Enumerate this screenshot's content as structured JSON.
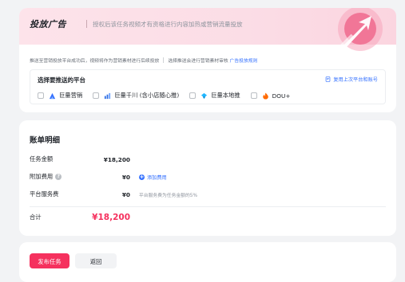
{
  "ad_section": {
    "title": "投放广告",
    "description": "授权后该任务视频才有资格进行内容加热或营销流量投放",
    "notice": "推送至营销投放平台成功后，视频将作为营销素材进行后续投放",
    "notice_select": "选择推送会进行营销素材审核",
    "rules_link": "广告投放规则",
    "platform_title": "选择要推送的平台",
    "reuse_link": "复用上次平台和账号",
    "platforms": [
      {
        "label": "巨量营销",
        "icon": "ocean-engine-icon",
        "color": "#3370ff",
        "checked": false
      },
      {
        "label": "巨量千川 (含小店随心推)",
        "icon": "qianchuan-icon",
        "color": "#2f6fe4",
        "checked": false
      },
      {
        "label": "巨量本地推",
        "icon": "local-push-icon",
        "color": "#1fb6ff",
        "checked": false
      },
      {
        "label": "DOU+",
        "icon": "dou-plus-icon",
        "color": "#ff6a00",
        "checked": false
      }
    ]
  },
  "bill": {
    "title": "账单明细",
    "task_amount_label": "任务金额",
    "task_amount": "¥18,200",
    "extra_fee_label": "附加费用",
    "extra_fee": "¥0",
    "add_fee_link": "添加费用",
    "service_fee_label": "平台服务费",
    "service_fee": "¥0",
    "service_fee_note": "平台服务费为任务金额的5%",
    "total_label": "合计",
    "total_amount": "¥18,200"
  },
  "footer": {
    "publish_label": "发布任务",
    "back_label": "返回"
  },
  "colors": {
    "accent": "#f5315e",
    "link": "#3370ff",
    "header_bg": "#fde3ea"
  }
}
